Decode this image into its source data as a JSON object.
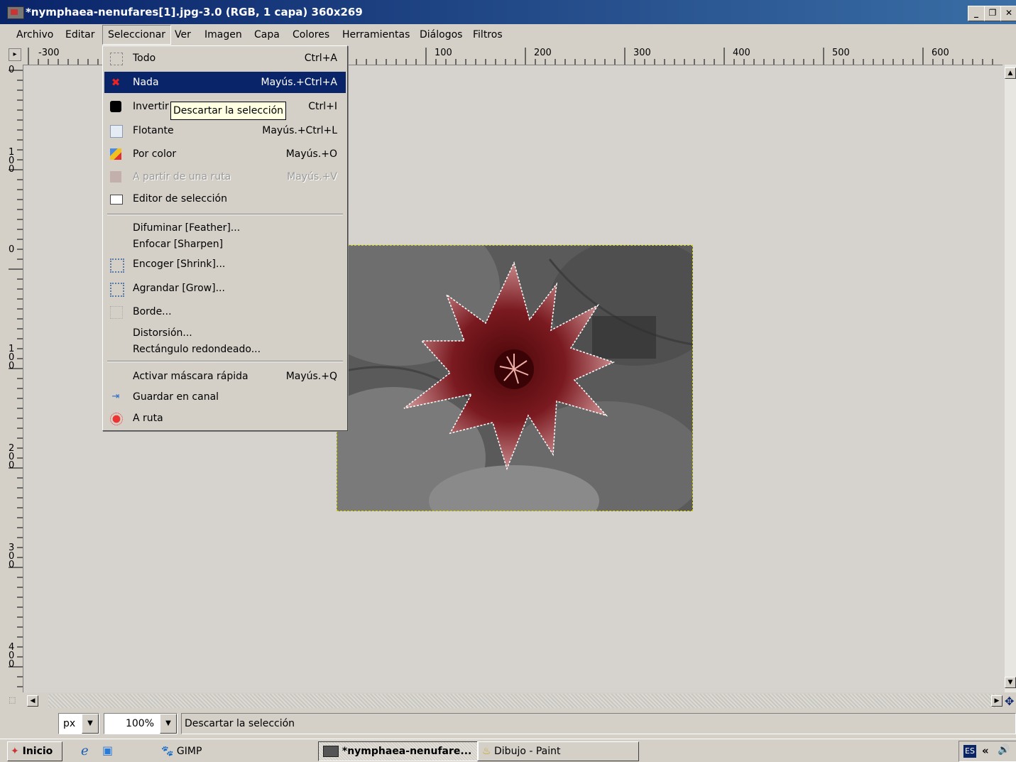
{
  "window": {
    "title": "*nymphaea-nenufares[1].jpg-3.0 (RGB, 1 capa) 360x269",
    "minimize": "_",
    "restore": "❐",
    "close": "✕"
  },
  "menubar": [
    "Archivo",
    "Editar",
    "Seleccionar",
    "Ver",
    "Imagen",
    "Capa",
    "Colores",
    "Herramientas",
    "Diálogos",
    "Filtros"
  ],
  "ruler_top": [
    "-300",
    "100",
    "200",
    "300",
    "400",
    "500",
    "600"
  ],
  "ruler_left": [
    "0",
    "100",
    "0",
    "100",
    "200",
    "300",
    "400"
  ],
  "dropdown": {
    "items": [
      {
        "label": "Todo",
        "shortcut": "Ctrl+A",
        "icon": "select-all-icon"
      },
      {
        "label": "Nada",
        "shortcut": "Mayús.+Ctrl+A",
        "icon": "select-none-icon",
        "highlighted": true
      },
      {
        "label": "Invertir",
        "shortcut": "Ctrl+I",
        "icon": "invert-icon"
      },
      {
        "label": "Flotante",
        "shortcut": "Mayús.+Ctrl+L",
        "icon": "float-icon"
      },
      {
        "label": "Por color",
        "shortcut": "Mayús.+O",
        "icon": "by-color-icon"
      },
      {
        "label": "A partir de una ruta",
        "shortcut": "Mayús.+V",
        "icon": "from-path-icon",
        "disabled": true
      },
      {
        "label": "Editor de selección",
        "shortcut": "",
        "icon": "selection-editor-icon"
      },
      {
        "label": "Difuminar [Feather]...",
        "shortcut": "",
        "icon": ""
      },
      {
        "label": "Enfocar [Sharpen]",
        "shortcut": "",
        "icon": ""
      },
      {
        "label": "Encoger [Shrink]...",
        "shortcut": "",
        "icon": "shrink-icon"
      },
      {
        "label": "Agrandar [Grow]...",
        "shortcut": "",
        "icon": "grow-icon"
      },
      {
        "label": "Borde...",
        "shortcut": "",
        "icon": "border-icon"
      },
      {
        "label": "Distorsión...",
        "shortcut": "",
        "icon": ""
      },
      {
        "label": "Rectángulo redondeado...",
        "shortcut": "",
        "icon": ""
      },
      {
        "label": "Activar máscara rápida",
        "shortcut": "Mayús.+Q",
        "icon": ""
      },
      {
        "label": "Guardar en canal",
        "shortcut": "",
        "icon": "save-channel-icon"
      },
      {
        "label": "A ruta",
        "shortcut": "",
        "icon": "to-path-icon"
      }
    ]
  },
  "tooltip": "Descartar la selección",
  "status": {
    "unit": "px",
    "zoom": "100%",
    "message": "Descartar la selección"
  },
  "taskbar": {
    "start": "Inicio",
    "gimp": "GIMP",
    "image_window": "*nymphaea-nenufare...",
    "paint": "Dibujo - Paint",
    "lang": "ES",
    "chevron": "«"
  },
  "colors": {
    "titlebar": "#0a246a",
    "menu_highlight": "#0a246a",
    "canvas": "#d6d3ce",
    "tooltip": "#ffffe1"
  }
}
